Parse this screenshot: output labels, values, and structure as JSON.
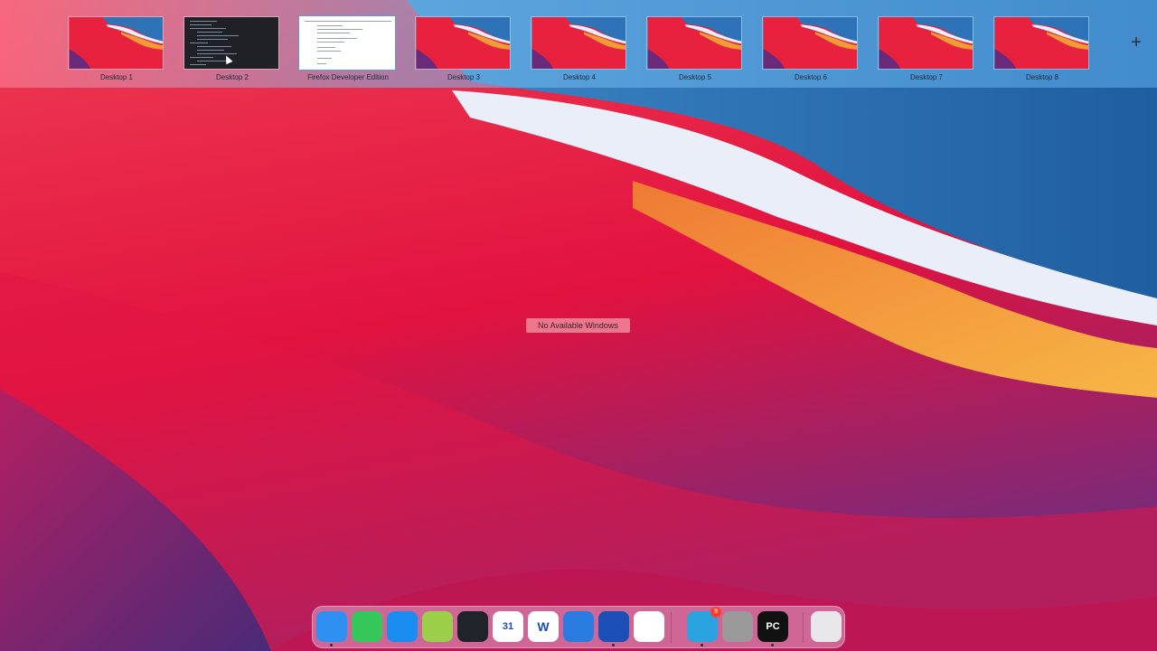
{
  "spaces": [
    {
      "label": "Desktop 1",
      "kind": "wallpaper"
    },
    {
      "label": "Desktop 2",
      "kind": "code"
    },
    {
      "label": "Firefox Developer Edition",
      "kind": "firefox",
      "current": true
    },
    {
      "label": "Desktop 3",
      "kind": "wallpaper"
    },
    {
      "label": "Desktop 4",
      "kind": "wallpaper"
    },
    {
      "label": "Desktop 5",
      "kind": "wallpaper"
    },
    {
      "label": "Desktop 6",
      "kind": "wallpaper"
    },
    {
      "label": "Desktop 7",
      "kind": "wallpaper"
    },
    {
      "label": "Desktop 8",
      "kind": "wallpaper"
    }
  ],
  "add_space_icon": "plus-icon",
  "add_space_glyph": "+",
  "no_windows_text": "No Available Windows",
  "dock": {
    "items": [
      {
        "name": "finder-icon",
        "color": "#2f8ff0",
        "running": true
      },
      {
        "name": "messages-icon",
        "color": "#35c759",
        "running": false
      },
      {
        "name": "app-store-icon",
        "color": "#1b8cf0",
        "running": false
      },
      {
        "name": "android-studio-icon",
        "color": "#9bcf4a",
        "running": false
      },
      {
        "name": "react-devtools-icon",
        "color": "#20232a",
        "running": false
      },
      {
        "name": "calendar-icon",
        "color": "#ffffff",
        "running": false,
        "text": "31"
      },
      {
        "name": "word-icon",
        "color": "#ffffff",
        "running": false,
        "text": "W"
      },
      {
        "name": "remote-desktop-icon",
        "color": "#2a7be0",
        "running": false
      },
      {
        "name": "firefox-developer-icon",
        "color": "#1b4fb5",
        "running": true
      },
      {
        "name": "chrome-icon",
        "color": "#ffffff",
        "running": false
      },
      {
        "name": "telegram-icon",
        "color": "#2aa3e0",
        "running": true,
        "badge": "9"
      },
      {
        "name": "database-icon",
        "color": "#9a9a9a",
        "running": false
      },
      {
        "name": "pycharm-icon",
        "color": "#111111",
        "running": true,
        "text": "PC"
      },
      {
        "name": "trash-icon",
        "color": "#e8e8ec",
        "running": false
      }
    ]
  },
  "colors": {
    "wallpaper_red": "#e8213f",
    "wallpaper_orange": "#f29a35",
    "wallpaper_blue": "#2e73b8",
    "wallpaper_purple": "#6a2a7a"
  }
}
